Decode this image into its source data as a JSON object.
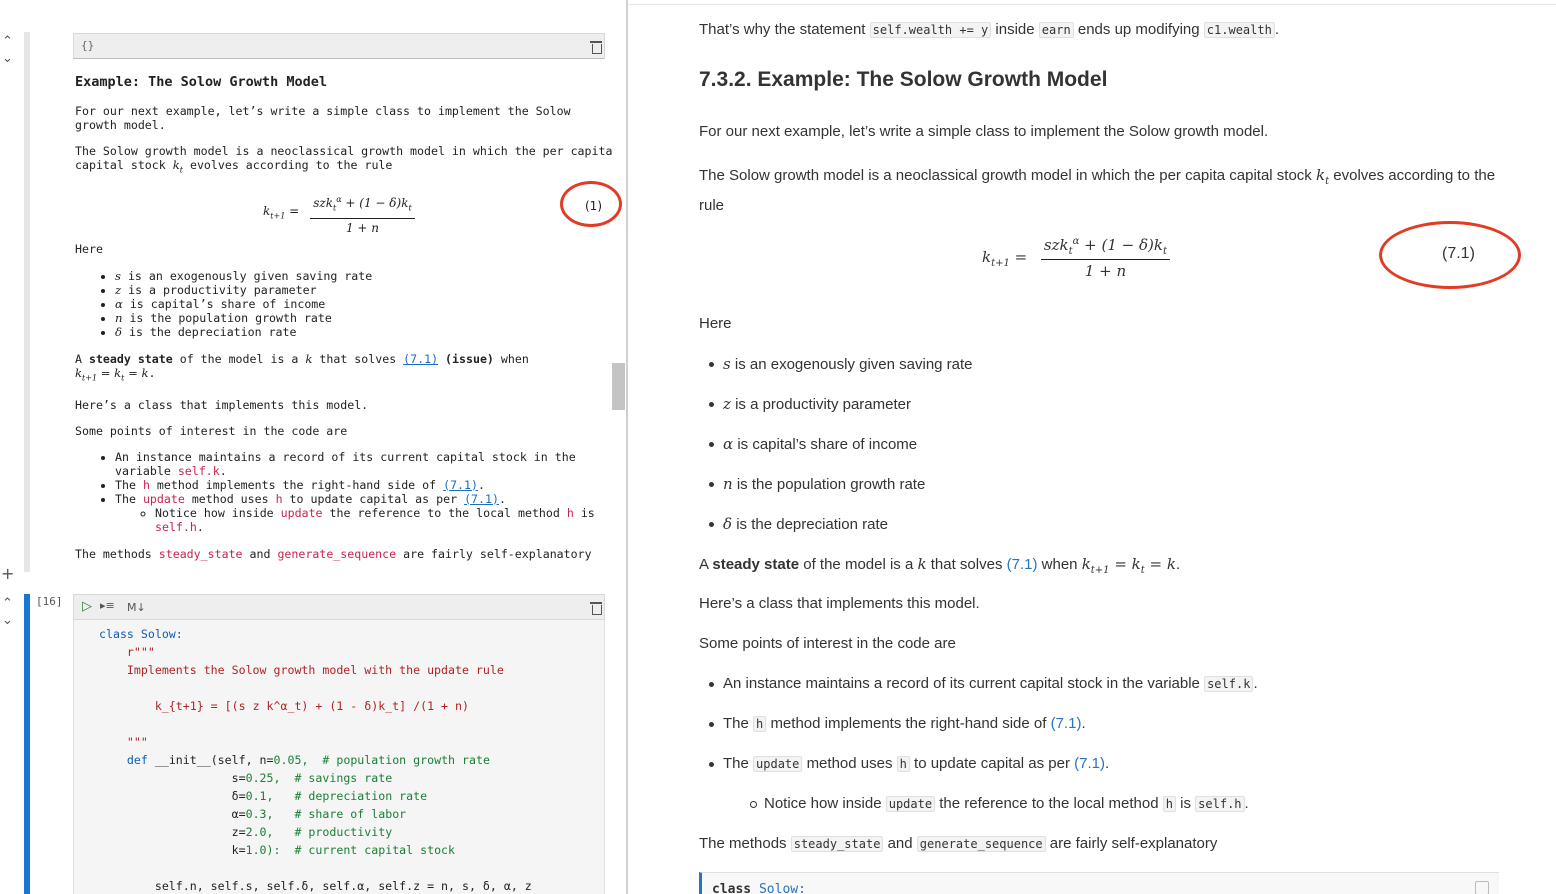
{
  "notebook": {
    "md_cell": {
      "toolbar_icon": "{}",
      "heading": "Example: The Solow Growth Model",
      "p1": "For our next example, let’s write a simple class to implement the Solow growth model.",
      "p2_pre": "The Solow growth model is a neoclassical growth model in which the per capita capital stock",
      "p2_post": "evolves according to the rule",
      "eq_number": "(1)",
      "here": "Here",
      "bullets": [
        {
          "sym": "s",
          "text": "is an exogenously given saving rate"
        },
        {
          "sym": "z",
          "text": "is a productivity parameter"
        },
        {
          "sym": "α",
          "text": "is capital’s share of income"
        },
        {
          "sym": "n",
          "text": "is the population growth rate"
        },
        {
          "sym": "δ",
          "text": "is the depreciation rate"
        }
      ],
      "steady_pre": "A",
      "steady_bold": "steady state",
      "steady_mid": "of the model is a",
      "steady_solves": "that solves",
      "steady_ref": "(7.1)",
      "steady_issue": "(issue)",
      "steady_when": "when",
      "p_class": "Here’s a class that implements this model.",
      "p_points": "Some points of interest in the code are",
      "code_bullets": {
        "b1_pre": "An instance maintains a record of its current capital stock in the variable",
        "b1_code": "self.k",
        "b2_pre": "The",
        "b2_code": "h",
        "b2_post": "method implements the right-hand side of",
        "b2_ref": "(7.1)",
        "b3_pre": "The",
        "b3_code": "update",
        "b3_mid": "method uses",
        "b3_code2": "h",
        "b3_post": "to update capital as per",
        "b3_ref": "(7.1)",
        "sub_pre": "Notice how inside",
        "sub_code": "update",
        "sub_mid": "the reference to the local method",
        "sub_code2": "h",
        "sub_is": "is",
        "sub_code3": "self.h"
      },
      "p_methods_pre": "The methods",
      "p_methods_c1": "steady_state",
      "p_methods_and": "and",
      "p_methods_c2": "generate_sequence",
      "p_methods_post": "are fairly self-explanatory"
    },
    "code_cell": {
      "exec_count": "[16]",
      "md_label": "M↓",
      "lines": {
        "l1_kw": "class",
        "l1_name": "Solow:",
        "l2": "r\"\"\"",
        "l3": "Implements the Solow growth model with the update rule",
        "l4": "k_{t+1} = [(s z k^α_t) + (1 - δ)k_t] /(1 + n)",
        "l5": "\"\"\"",
        "l6_kw": "def",
        "l6_name": "__init__(self, n=",
        "l6_val": "0.05,",
        "l6_cm": "# population growth rate",
        "l7_name": "s=",
        "l7_val": "0.25,",
        "l7_cm": "# savings rate",
        "l8_name": "δ=",
        "l8_val": "0.1,",
        "l8_cm": "# depreciation rate",
        "l9_name": "α=",
        "l9_val": "0.3,",
        "l9_cm": "# share of labor",
        "l10_name": "z=",
        "l10_val": "2.0,",
        "l10_cm": "# productivity",
        "l11_name": "k=",
        "l11_val": "1.0):",
        "l11_cm": "# current capital stock",
        "l12": "self.n, self.s, self.δ, self.α, self.z = n, s, δ, α, z"
      }
    }
  },
  "page": {
    "top_pre": "That’s why the statement",
    "top_code1": "self.wealth += y",
    "top_mid": "inside",
    "top_code2": "earn",
    "top_post": "ends up modifying",
    "top_code3": "c1.wealth",
    "heading": "7.3.2. Example: The Solow Growth Model",
    "p1": "For our next example, let’s write a simple class to implement the Solow growth model.",
    "p2_pre": "The Solow growth model is a neoclassical growth model in which the per capita capital stock",
    "p2_post": "evolves according to the",
    "p2_line2": "rule",
    "eq_number": "(7.1)",
    "here": "Here",
    "bullets": [
      {
        "sym": "s",
        "text": "is an exogenously given saving rate"
      },
      {
        "sym": "z",
        "text": "is a productivity parameter"
      },
      {
        "sym": "α",
        "text": "is capital’s share of income"
      },
      {
        "sym": "n",
        "text": "is the population growth rate"
      },
      {
        "sym": "δ",
        "text": "is the depreciation rate"
      }
    ],
    "steady_pre": "A",
    "steady_bold": "steady state",
    "steady_mid": "of the model is a",
    "steady_solves": "that solves",
    "steady_ref": "(7.1)",
    "steady_when": "when",
    "p_class": "Here’s a class that implements this model.",
    "p_points": "Some points of interest in the code are",
    "code_bullets": {
      "b1_pre": "An instance maintains a record of its current capital stock in the variable",
      "b1_code": "self.k",
      "b2_pre": "The",
      "b2_code": "h",
      "b2_post": "method implements the right-hand side of",
      "b2_ref": "(7.1)",
      "b3_pre": "The",
      "b3_code": "update",
      "b3_mid": "method uses",
      "b3_code2": "h",
      "b3_post": "to update capital as per",
      "b3_ref": "(7.1)",
      "sub_pre": "Notice how inside",
      "sub_code": "update",
      "sub_mid": "the reference to the local method",
      "sub_code2": "h",
      "sub_is": "is",
      "sub_code3": "self.h"
    },
    "p_methods_pre": "The methods",
    "p_methods_c1": "steady_state",
    "p_methods_and": "and",
    "p_methods_c2": "generate_sequence",
    "p_methods_post": "are fairly self-explanatory",
    "code_preview_kw": "class",
    "code_preview_name": "Solow:"
  },
  "colors": {
    "annotation_circle": "#e03c26",
    "active_cell_bar": "#1976d2",
    "inactive_cell_bar": "#e0e0e0",
    "link": "#2a72c3",
    "inline_code_red": "#c7254e"
  },
  "icons": [
    "chevron-up-icon",
    "chevron-down-icon",
    "plus-icon",
    "trash-icon",
    "run-icon",
    "run-all-icon"
  ]
}
